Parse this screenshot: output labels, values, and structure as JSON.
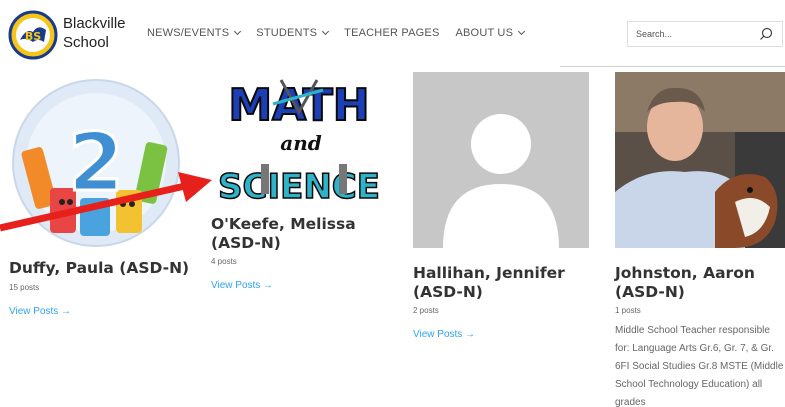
{
  "header": {
    "logo_text": "BS",
    "school_name_line1": "Blackville",
    "school_name_line2": "School",
    "nav": [
      {
        "label": "NEWS/EVENTS",
        "has_dropdown": true
      },
      {
        "label": "STUDENTS",
        "has_dropdown": true
      },
      {
        "label": "TEACHER PAGES",
        "has_dropdown": false
      },
      {
        "label": "ABOUT US",
        "has_dropdown": true
      }
    ],
    "search": {
      "placeholder": "Search..."
    }
  },
  "authors": [
    {
      "name_line1": "Duffy, Paula (ASD-N)",
      "name_line2": "",
      "posts": "15 posts",
      "link": "View Posts →",
      "image_icon": "grade-2-crayons-icon",
      "image_text": "2"
    },
    {
      "name_line1": "O'Keefe, Melissa",
      "name_line2": "(ASD-N)",
      "posts": "4 posts",
      "link": "View Posts →",
      "image_icon": "math-and-science-logo",
      "image_text_top": "MATH",
      "image_text_mid": "and",
      "image_text_bottom": "SCIENCE"
    },
    {
      "name_line1": "Hallihan, Jennifer",
      "name_line2": "(ASD-N)",
      "posts": "2 posts",
      "link": "View Posts →",
      "image_icon": "default-avatar-icon"
    },
    {
      "name_line1": "Johnston, Aaron",
      "name_line2": "(ASD-N)",
      "posts": "1 posts",
      "image_icon": "teacher-photo-with-dog",
      "bio": [
        "Middle School Teacher responsible",
        "for: Language Arts Gr.6, Gr. 7, & Gr.",
        "6FI Social Studies Gr.8 MSTE (Middle",
        "School Technology Education) all",
        "grades"
      ]
    }
  ],
  "colors": {
    "link": "#2ea3f2",
    "arrow": "#e8201c",
    "placeholder": "#c7c7c7"
  }
}
